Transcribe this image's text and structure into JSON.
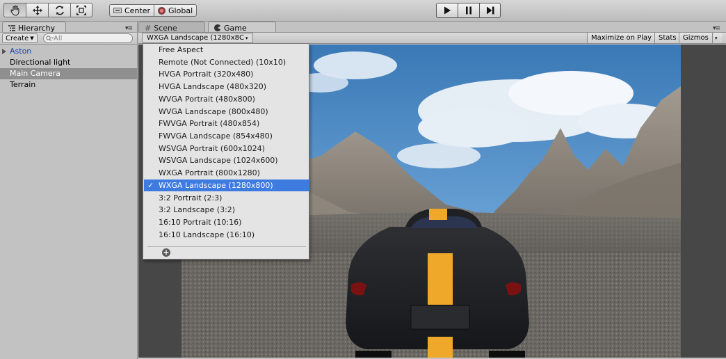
{
  "toolbar": {
    "tools": [
      {
        "icon": "hand-icon",
        "selected": true
      },
      {
        "icon": "move-icon",
        "selected": false
      },
      {
        "icon": "rotate-icon",
        "selected": false
      },
      {
        "icon": "scale-icon",
        "selected": false
      }
    ],
    "pivot_label": "Center",
    "space_label": "Global",
    "playback": [
      "play-icon",
      "pause-icon",
      "step-icon"
    ]
  },
  "hierarchy": {
    "tab_label": "Hierarchy",
    "create_label": "Create",
    "search_placeholder": "All",
    "items": [
      {
        "label": "Aston",
        "prefab": true,
        "expandable": true,
        "selected": false
      },
      {
        "label": "Directional light",
        "prefab": false,
        "expandable": false,
        "selected": false
      },
      {
        "label": "Main Camera",
        "prefab": false,
        "expandable": false,
        "selected": true
      },
      {
        "label": "Terrain",
        "prefab": false,
        "expandable": false,
        "selected": false
      }
    ]
  },
  "tabs": {
    "scene_label": "Scene",
    "game_label": "Game"
  },
  "game_toolbar": {
    "aspect_value": "WXGA Landscape (1280x8C",
    "maximize_label": "Maximize on Play",
    "stats_label": "Stats",
    "gizmos_label": "Gizmos"
  },
  "aspect_menu": {
    "items": [
      "Free Aspect",
      "Remote (Not Connected) (10x10)",
      "HVGA Portrait (320x480)",
      "HVGA Landscape (480x320)",
      "WVGA Portrait (480x800)",
      "WVGA Landscape (800x480)",
      "FWVGA Portrait (480x854)",
      "FWVGA Landscape (854x480)",
      "WSVGA Portrait (600x1024)",
      "WSVGA Landscape (1024x600)",
      "WXGA Portrait (800x1280)",
      "WXGA Landscape (1280x800)",
      "3:2 Portrait (2:3)",
      "3:2 Landscape (3:2)",
      "16:10 Portrait (10:16)",
      "16:10 Landscape (16:10)"
    ],
    "selected_index": 11,
    "check_mark": "✓",
    "add_label": "+"
  },
  "colors": {
    "accent": "#3d7be0",
    "prefab_text": "#1c3fa6",
    "selection_gray": "#8f8f8f",
    "car_stripe": "#f0a82a"
  }
}
